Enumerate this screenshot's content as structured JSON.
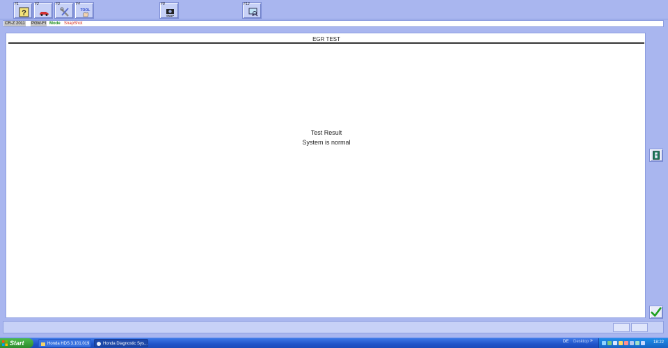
{
  "toolbar": {
    "keys": [
      {
        "label": "F1",
        "icon": "help-question-icon"
      },
      {
        "label": "F2",
        "icon": "vehicle-car-icon"
      },
      {
        "label": "F3",
        "icon": "wrench-tools-icon"
      },
      {
        "label": "F4",
        "icon": "tool-hand-icon",
        "text": "TOOL"
      },
      {
        "label": "F8",
        "icon": "snapshot-camera-icon",
        "text": "SNAP"
      },
      {
        "label": "F12",
        "icon": "report-monitor-icon"
      }
    ]
  },
  "status": {
    "model": "CR-Z 2011",
    "system": "PGM-FI",
    "mode_label": "Mode",
    "mode_value": "SnapShot"
  },
  "panel": {
    "title": "EGR TEST",
    "result_title": "Test Result",
    "result_value": "System is normal"
  },
  "side_buttons": {
    "exit_icon": "exit-door-icon",
    "ok_icon": "checkmark-icon"
  },
  "taskbar": {
    "start": "Start",
    "tasks": [
      "Honda HDS 3.101.019",
      "Honda Diagnostic Sys..."
    ],
    "language": "DE",
    "desktop": "Desktop",
    "chevron": "»",
    "time": "18:22"
  },
  "colors": {
    "window_bg": "#a9b6ef",
    "mode_green": "#1a8a1a",
    "snapshot_red": "#d42a1a",
    "taskbar_blue": "#245edb",
    "start_green": "#3aa83a",
    "ok_check_green": "#1fa01f"
  }
}
